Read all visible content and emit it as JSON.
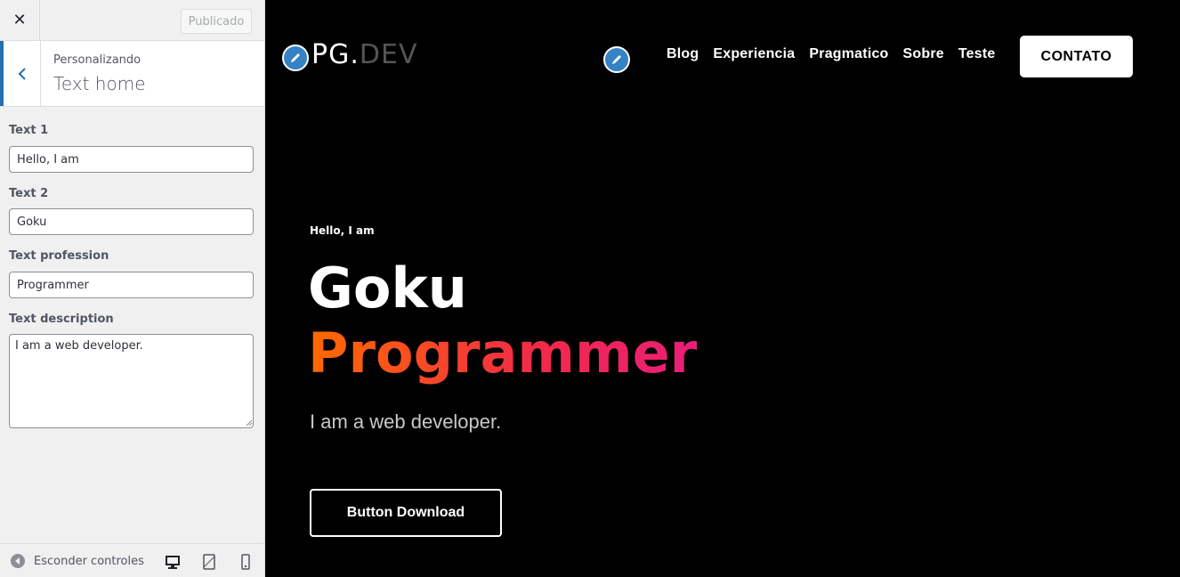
{
  "customizer": {
    "publish_label": "Publicado",
    "breadcrumb_small": "Personalizando",
    "section_title": "Text home",
    "fields": [
      {
        "label": "Text 1",
        "value": "Hello, I am"
      },
      {
        "label": "Text 2",
        "value": "Goku"
      },
      {
        "label": "Text profession",
        "value": "Programmer"
      },
      {
        "label": "Text description",
        "value": "I am a web developer."
      }
    ],
    "footer": {
      "hide_controls_label": "Esconder controles",
      "devices": [
        "desktop-icon",
        "tablet-icon",
        "mobile-icon"
      ]
    }
  },
  "preview": {
    "logo": {
      "part1": "PG",
      "part2": ".",
      "part3": "DEV"
    },
    "nav": [
      "Blog",
      "Experiencia",
      "Pragmatico",
      "Sobre",
      "Teste"
    ],
    "cta_label": "CONTATO",
    "hero": {
      "greeting": "Hello, I am",
      "name": "Goku",
      "profession": "Programmer",
      "description": "I am a web developer.",
      "button_label": "Button Download"
    },
    "colors": {
      "accent_blue": "#3582c4",
      "gradient_start": "#ff6a00",
      "gradient_end": "#e91e7a"
    }
  }
}
